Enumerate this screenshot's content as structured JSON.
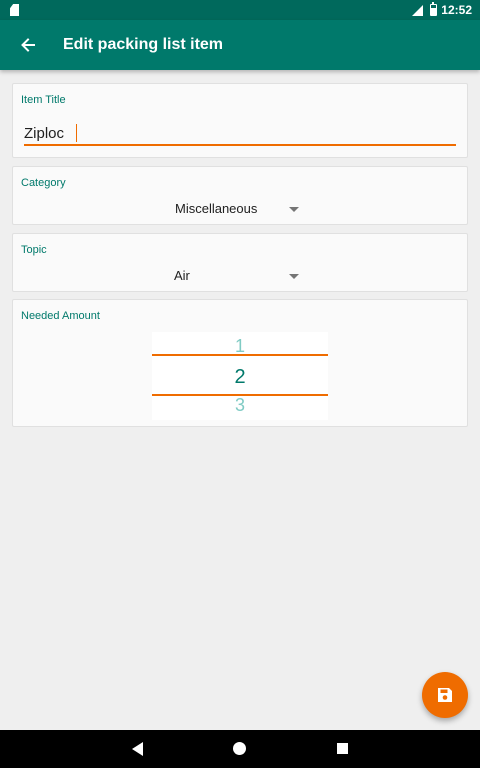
{
  "status_bar": {
    "time": "12:52",
    "icons": [
      "sd-card-icon",
      "signal-icon",
      "battery-icon"
    ]
  },
  "app_bar": {
    "title": "Edit packing list item",
    "back_icon": "arrow-back-icon"
  },
  "item_title": {
    "label": "Item Title",
    "value": "Ziploc"
  },
  "category": {
    "label": "Category",
    "selected": "Miscellaneous"
  },
  "topic": {
    "label": "Topic",
    "selected": "Air"
  },
  "needed_amount": {
    "label": "Needed Amount",
    "previous": "1",
    "current": "2",
    "next": "3"
  },
  "fab": {
    "icon": "save-icon"
  },
  "nav_bar": {
    "icons": [
      "nav-back-icon",
      "nav-home-icon",
      "nav-recents-icon"
    ]
  },
  "colors": {
    "primary": "#00796b",
    "primary_dark": "#00695c",
    "accent": "#ef6c00",
    "background": "#efefef",
    "card": "#fafafa"
  }
}
